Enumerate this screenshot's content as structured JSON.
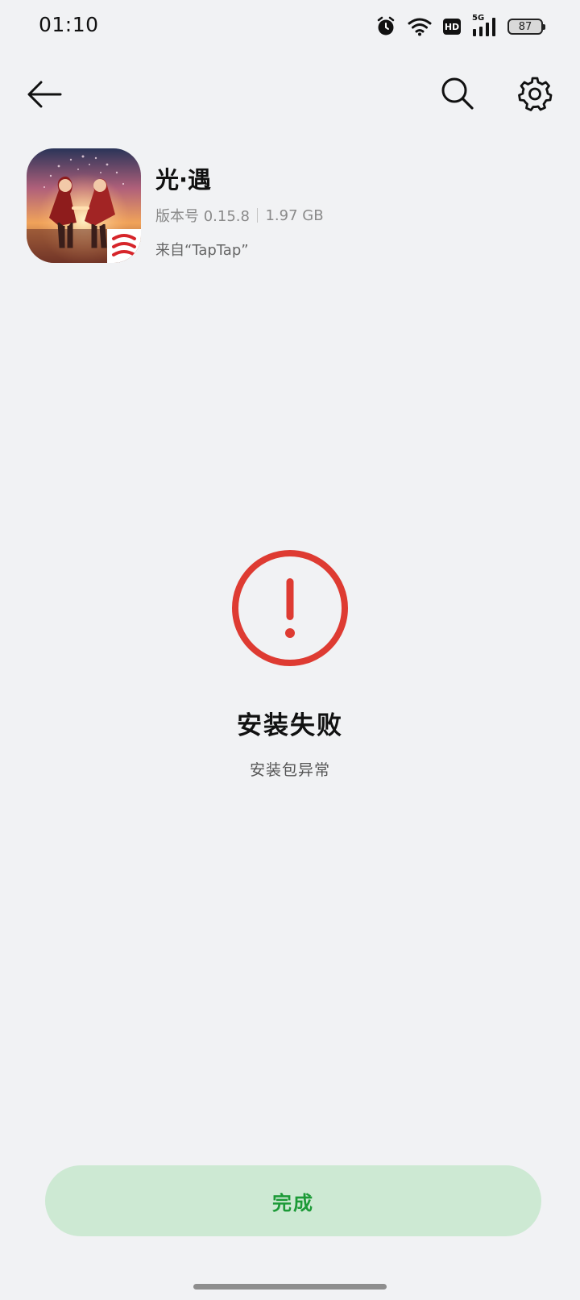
{
  "status_bar": {
    "time": "01:10",
    "icons": [
      "alarm-icon",
      "wifi-icon",
      "hd-icon",
      "signal-5g-icon",
      "battery-icon"
    ],
    "hd_label": "HD",
    "network_label": "5G",
    "battery_level": "87"
  },
  "nav": {
    "icons": [
      "back-arrow-icon",
      "search-icon",
      "gear-icon"
    ]
  },
  "app": {
    "name": "光·遇",
    "version_label": "版本号 0.15.8",
    "size": "1.97 GB",
    "source": "来自“TapTap”"
  },
  "result": {
    "icon": "exclamation-circle-icon",
    "title": "安装失败",
    "reason": "安装包异常",
    "accent_color": "#de3b32"
  },
  "footer": {
    "done_label": "完成",
    "done_color": "#1c9a37",
    "done_bg": "#cde9d3"
  }
}
